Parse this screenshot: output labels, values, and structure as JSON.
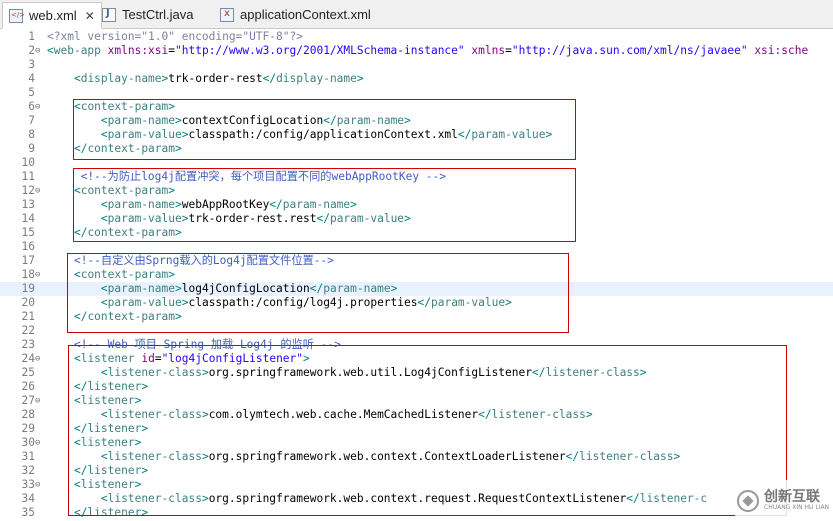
{
  "tabs": [
    {
      "label": "web.xml",
      "icon": "xml-file-icon",
      "active": true,
      "close": "✕"
    },
    {
      "label": "TestCtrl.java",
      "icon": "java-file-icon",
      "active": false
    },
    {
      "label": "applicationContext.xml",
      "icon": "xml-file-icon",
      "active": false
    }
  ],
  "editor": {
    "highlighted_line": 19,
    "lines": [
      {
        "n": "1",
        "fold": "",
        "tokens": [
          [
            "p",
            "<?xml version=\"1.0\" encoding=\"UTF-8\"?>"
          ]
        ]
      },
      {
        "n": "2",
        "fold": "⊖",
        "tokens": [
          [
            "b",
            "<"
          ],
          [
            "t",
            "web-app "
          ],
          [
            "a",
            "xmlns:xsi"
          ],
          [
            "tx",
            "="
          ],
          [
            "v",
            "\"http://www.w3.org/2001/XMLSchema-instance\" "
          ],
          [
            "a",
            "xmlns"
          ],
          [
            "tx",
            "="
          ],
          [
            "v",
            "\"http://java.sun.com/xml/ns/javaee\" "
          ],
          [
            "a",
            "xsi:sche"
          ]
        ]
      },
      {
        "n": "3",
        "fold": "",
        "tokens": []
      },
      {
        "n": "4",
        "fold": "",
        "tokens": [
          [
            "tx",
            "    "
          ],
          [
            "b",
            "<"
          ],
          [
            "t",
            "display-name"
          ],
          [
            "b",
            ">"
          ],
          [
            "tx",
            "trk-order-rest"
          ],
          [
            "b",
            "</"
          ],
          [
            "t",
            "display-name"
          ],
          [
            "b",
            ">"
          ]
        ]
      },
      {
        "n": "5",
        "fold": "",
        "tokens": []
      },
      {
        "n": "6",
        "fold": "⊖",
        "tokens": [
          [
            "tx",
            "    "
          ],
          [
            "b",
            "<"
          ],
          [
            "t",
            "context-param"
          ],
          [
            "b",
            ">"
          ]
        ]
      },
      {
        "n": "7",
        "fold": "",
        "tokens": [
          [
            "tx",
            "        "
          ],
          [
            "b",
            "<"
          ],
          [
            "t",
            "param-name"
          ],
          [
            "b",
            ">"
          ],
          [
            "tx",
            "contextConfigLocation"
          ],
          [
            "b",
            "</"
          ],
          [
            "t",
            "param-name"
          ],
          [
            "b",
            ">"
          ]
        ]
      },
      {
        "n": "8",
        "fold": "",
        "tokens": [
          [
            "tx",
            "        "
          ],
          [
            "b",
            "<"
          ],
          [
            "t",
            "param-value"
          ],
          [
            "b",
            ">"
          ],
          [
            "tx",
            "classpath:/config/applicationContext.xml"
          ],
          [
            "b",
            "</"
          ],
          [
            "t",
            "param-value"
          ],
          [
            "b",
            ">"
          ]
        ]
      },
      {
        "n": "9",
        "fold": "",
        "tokens": [
          [
            "tx",
            "    "
          ],
          [
            "b",
            "</"
          ],
          [
            "t",
            "context-param"
          ],
          [
            "b",
            ">"
          ]
        ]
      },
      {
        "n": "10",
        "fold": "",
        "tokens": []
      },
      {
        "n": "11",
        "fold": "",
        "tokens": [
          [
            "tx",
            "     "
          ],
          [
            "c",
            "<!--为防止log4j配置冲突，每个项目配置不同的webAppRootKey -->"
          ]
        ]
      },
      {
        "n": "12",
        "fold": "⊖",
        "tokens": [
          [
            "tx",
            "    "
          ],
          [
            "b",
            "<"
          ],
          [
            "t",
            "context-param"
          ],
          [
            "b",
            ">"
          ]
        ]
      },
      {
        "n": "13",
        "fold": "",
        "tokens": [
          [
            "tx",
            "        "
          ],
          [
            "b",
            "<"
          ],
          [
            "t",
            "param-name"
          ],
          [
            "b",
            ">"
          ],
          [
            "tx",
            "webAppRootKey"
          ],
          [
            "b",
            "</"
          ],
          [
            "t",
            "param-name"
          ],
          [
            "b",
            ">"
          ]
        ]
      },
      {
        "n": "14",
        "fold": "",
        "tokens": [
          [
            "tx",
            "        "
          ],
          [
            "b",
            "<"
          ],
          [
            "t",
            "param-value"
          ],
          [
            "b",
            ">"
          ],
          [
            "tx",
            "trk-order-rest.rest"
          ],
          [
            "b",
            "</"
          ],
          [
            "t",
            "param-value"
          ],
          [
            "b",
            ">"
          ]
        ]
      },
      {
        "n": "15",
        "fold": "",
        "tokens": [
          [
            "tx",
            "    "
          ],
          [
            "b",
            "</"
          ],
          [
            "t",
            "context-param"
          ],
          [
            "b",
            ">"
          ]
        ]
      },
      {
        "n": "16",
        "fold": "",
        "tokens": []
      },
      {
        "n": "17",
        "fold": "",
        "tokens": [
          [
            "tx",
            "    "
          ],
          [
            "c",
            "<!--自定义由Sprng载入的Log4j配置文件位置-->"
          ]
        ]
      },
      {
        "n": "18",
        "fold": "⊖",
        "tokens": [
          [
            "tx",
            "    "
          ],
          [
            "b",
            "<"
          ],
          [
            "t",
            "context-param"
          ],
          [
            "b",
            ">"
          ]
        ]
      },
      {
        "n": "19",
        "fold": "",
        "tokens": [
          [
            "tx",
            "        "
          ],
          [
            "b",
            "<"
          ],
          [
            "t",
            "param-name"
          ],
          [
            "b",
            ">"
          ],
          [
            "tx",
            "log4jConfigLocation"
          ],
          [
            "b",
            "</"
          ],
          [
            "t",
            "param-name"
          ],
          [
            "b",
            ">"
          ]
        ]
      },
      {
        "n": "20",
        "fold": "",
        "tokens": [
          [
            "tx",
            "        "
          ],
          [
            "b",
            "<"
          ],
          [
            "t",
            "param-value"
          ],
          [
            "b",
            ">"
          ],
          [
            "tx",
            "classpath:/config/log4j.properties"
          ],
          [
            "b",
            "</"
          ],
          [
            "t",
            "param-value"
          ],
          [
            "b",
            ">"
          ]
        ]
      },
      {
        "n": "21",
        "fold": "",
        "tokens": [
          [
            "tx",
            "    "
          ],
          [
            "b",
            "</"
          ],
          [
            "t",
            "context-param"
          ],
          [
            "b",
            ">"
          ]
        ]
      },
      {
        "n": "22",
        "fold": "",
        "tokens": []
      },
      {
        "n": "23",
        "fold": "",
        "tokens": [
          [
            "tx",
            "    "
          ],
          [
            "c",
            "<!-- Web 项目 Spring 加载 Log4j 的监听 -->"
          ]
        ]
      },
      {
        "n": "24",
        "fold": "⊖",
        "tokens": [
          [
            "tx",
            "    "
          ],
          [
            "b",
            "<"
          ],
          [
            "t",
            "listener "
          ],
          [
            "a",
            "id"
          ],
          [
            "tx",
            "="
          ],
          [
            "v",
            "\"log4jConfigListener\""
          ],
          [
            "b",
            ">"
          ]
        ]
      },
      {
        "n": "25",
        "fold": "",
        "tokens": [
          [
            "tx",
            "        "
          ],
          [
            "b",
            "<"
          ],
          [
            "t",
            "listener-class"
          ],
          [
            "b",
            ">"
          ],
          [
            "tx",
            "org.springframework.web.util.Log4jConfigListener"
          ],
          [
            "b",
            "</"
          ],
          [
            "t",
            "listener-class"
          ],
          [
            "b",
            ">"
          ]
        ]
      },
      {
        "n": "26",
        "fold": "",
        "tokens": [
          [
            "tx",
            "    "
          ],
          [
            "b",
            "</"
          ],
          [
            "t",
            "listener"
          ],
          [
            "b",
            ">"
          ]
        ]
      },
      {
        "n": "27",
        "fold": "⊖",
        "tokens": [
          [
            "tx",
            "    "
          ],
          [
            "b",
            "<"
          ],
          [
            "t",
            "listener"
          ],
          [
            "b",
            ">"
          ]
        ]
      },
      {
        "n": "28",
        "fold": "",
        "tokens": [
          [
            "tx",
            "        "
          ],
          [
            "b",
            "<"
          ],
          [
            "t",
            "listener-class"
          ],
          [
            "b",
            ">"
          ],
          [
            "tx",
            "com.olymtech.web.cache.MemCachedListener"
          ],
          [
            "b",
            "</"
          ],
          [
            "t",
            "listener-class"
          ],
          [
            "b",
            ">"
          ]
        ]
      },
      {
        "n": "29",
        "fold": "",
        "tokens": [
          [
            "tx",
            "    "
          ],
          [
            "b",
            "</"
          ],
          [
            "t",
            "listener"
          ],
          [
            "b",
            ">"
          ]
        ]
      },
      {
        "n": "30",
        "fold": "⊖",
        "tokens": [
          [
            "tx",
            "    "
          ],
          [
            "b",
            "<"
          ],
          [
            "t",
            "listener"
          ],
          [
            "b",
            ">"
          ]
        ]
      },
      {
        "n": "31",
        "fold": "",
        "tokens": [
          [
            "tx",
            "        "
          ],
          [
            "b",
            "<"
          ],
          [
            "t",
            "listener-class"
          ],
          [
            "b",
            ">"
          ],
          [
            "tx",
            "org.springframework.web.context.ContextLoaderListener"
          ],
          [
            "b",
            "</"
          ],
          [
            "t",
            "listener-class"
          ],
          [
            "b",
            ">"
          ]
        ]
      },
      {
        "n": "32",
        "fold": "",
        "tokens": [
          [
            "tx",
            "    "
          ],
          [
            "b",
            "</"
          ],
          [
            "t",
            "listener"
          ],
          [
            "b",
            ">"
          ]
        ]
      },
      {
        "n": "33",
        "fold": "⊖",
        "tokens": [
          [
            "tx",
            "    "
          ],
          [
            "b",
            "<"
          ],
          [
            "t",
            "listener"
          ],
          [
            "b",
            ">"
          ]
        ]
      },
      {
        "n": "34",
        "fold": "",
        "tokens": [
          [
            "tx",
            "        "
          ],
          [
            "b",
            "<"
          ],
          [
            "t",
            "listener-class"
          ],
          [
            "b",
            ">"
          ],
          [
            "tx",
            "org.springframework.web.context.request.RequestContextListener"
          ],
          [
            "b",
            "</"
          ],
          [
            "t",
            "listener-c"
          ]
        ]
      },
      {
        "n": "35",
        "fold": "",
        "tokens": [
          [
            "tx",
            "    "
          ],
          [
            "b",
            "</"
          ],
          [
            "t",
            "listener"
          ],
          [
            "b",
            ">"
          ]
        ]
      }
    ]
  },
  "watermark": {
    "cn": "创新互联",
    "en": "CHUANG XIN HU LIAN",
    "icon": "brand-logo-icon"
  }
}
